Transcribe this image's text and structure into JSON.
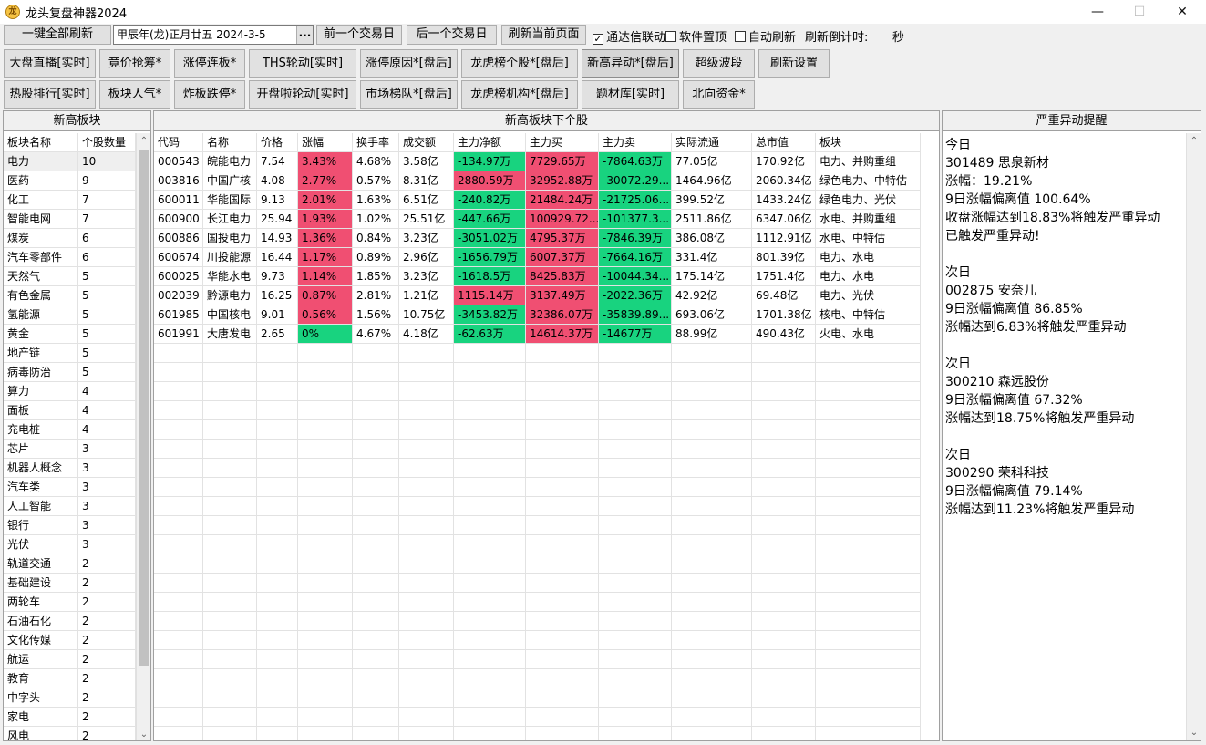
{
  "window": {
    "title": "龙头复盘神器2024",
    "app_icon_text": "龙",
    "minimize": "—",
    "maximize": "☐",
    "close": "✕"
  },
  "toolbar": {
    "refresh_all": "一键全部刷新",
    "date_value": "甲辰年(龙)正月廿五  2024-3-5",
    "date_picker": "...",
    "prev_day": "前一个交易日",
    "next_day": "后一个交易日",
    "refresh_page": "刷新当前页面",
    "tdx_link": "通达信联动",
    "tdx_link_checked": true,
    "pin_top": "软件置顶",
    "pin_top_checked": false,
    "auto_refresh": "自动刷新",
    "auto_refresh_checked": false,
    "countdown_label": "刷新倒计时:",
    "countdown_unit": "秒"
  },
  "nav_row1": [
    "大盘直播[实时]",
    "竟价抢筹*",
    "涨停连板*",
    "THS轮动[实时]",
    "涨停原因*[盘后]",
    "龙虎榜个股*[盘后]",
    "新高异动*[盘后]",
    "超级波段",
    "刷新设置"
  ],
  "nav_row2": [
    "热股排行[实时]",
    "板块人气*",
    "炸板跌停*",
    "开盘啦轮动[实时]",
    "市场梯队*[盘后]",
    "龙虎榜机构*[盘后]",
    "题材库[实时]",
    "北向资金*"
  ],
  "sectors": {
    "title": "新高板块",
    "columns": [
      "板块名称",
      "个股数量"
    ],
    "rows": [
      [
        "电力",
        "10"
      ],
      [
        "医药",
        "9"
      ],
      [
        "化工",
        "7"
      ],
      [
        "智能电网",
        "7"
      ],
      [
        "煤炭",
        "6"
      ],
      [
        "汽车零部件",
        "6"
      ],
      [
        "天然气",
        "5"
      ],
      [
        "有色金属",
        "5"
      ],
      [
        "氢能源",
        "5"
      ],
      [
        "黄金",
        "5"
      ],
      [
        "地产链",
        "5"
      ],
      [
        "病毒防治",
        "5"
      ],
      [
        "算力",
        "4"
      ],
      [
        "面板",
        "4"
      ],
      [
        "充电桩",
        "4"
      ],
      [
        "芯片",
        "3"
      ],
      [
        "机器人概念",
        "3"
      ],
      [
        "汽车类",
        "3"
      ],
      [
        "人工智能",
        "3"
      ],
      [
        "银行",
        "3"
      ],
      [
        "光伏",
        "3"
      ],
      [
        "轨道交通",
        "2"
      ],
      [
        "基础建设",
        "2"
      ],
      [
        "两轮车",
        "2"
      ],
      [
        "石油石化",
        "2"
      ],
      [
        "文化传媒",
        "2"
      ],
      [
        "航运",
        "2"
      ],
      [
        "教育",
        "2"
      ],
      [
        "中字头",
        "2"
      ],
      [
        "家电",
        "2"
      ],
      [
        "风电",
        "2"
      ]
    ]
  },
  "stocks": {
    "title": "新高板块下个股",
    "columns": [
      "代码",
      "名称",
      "价格",
      "涨幅",
      "换手率",
      "成交额",
      "主力净额",
      "主力买",
      "主力卖",
      "实际流通",
      "总市值",
      "板块"
    ],
    "rows": [
      [
        "000543",
        "皖能电力",
        "7.54",
        "3.43%",
        "4.68%",
        "3.58亿",
        "-134.97万",
        "7729.65万",
        "-7864.63万",
        "77.05亿",
        "170.92亿",
        "电力、并购重组"
      ],
      [
        "003816",
        "中国广核",
        "4.08",
        "2.77%",
        "0.57%",
        "8.31亿",
        "2880.59万",
        "32952.88万",
        "-30072.29...",
        "1464.96亿",
        "2060.34亿",
        "绿色电力、中特估"
      ],
      [
        "600011",
        "华能国际",
        "9.13",
        "2.01%",
        "1.63%",
        "6.51亿",
        "-240.82万",
        "21484.24万",
        "-21725.06...",
        "399.52亿",
        "1433.24亿",
        "绿色电力、光伏"
      ],
      [
        "600900",
        "长江电力",
        "25.94",
        "1.93%",
        "1.02%",
        "25.51亿",
        "-447.66万",
        "100929.72...",
        "-101377.3...",
        "2511.86亿",
        "6347.06亿",
        "水电、并购重组"
      ],
      [
        "600886",
        "国投电力",
        "14.93",
        "1.36%",
        "0.84%",
        "3.23亿",
        "-3051.02万",
        "4795.37万",
        "-7846.39万",
        "386.08亿",
        "1112.91亿",
        "水电、中特估"
      ],
      [
        "600674",
        "川投能源",
        "16.44",
        "1.17%",
        "0.89%",
        "2.96亿",
        "-1656.79万",
        "6007.37万",
        "-7664.16万",
        "331.4亿",
        "801.39亿",
        "电力、水电"
      ],
      [
        "600025",
        "华能水电",
        "9.73",
        "1.14%",
        "1.85%",
        "3.23亿",
        "-1618.5万",
        "8425.83万",
        "-10044.34...",
        "175.14亿",
        "1751.4亿",
        "电力、水电"
      ],
      [
        "002039",
        "黔源电力",
        "16.25",
        "0.87%",
        "2.81%",
        "1.21亿",
        "1115.14万",
        "3137.49万",
        "-2022.36万",
        "42.92亿",
        "69.48亿",
        "电力、光伏"
      ],
      [
        "601985",
        "中国核电",
        "9.01",
        "0.56%",
        "1.56%",
        "10.75亿",
        "-3453.82万",
        "32386.07万",
        "-35839.89...",
        "693.06亿",
        "1701.38亿",
        "核电、中特估"
      ],
      [
        "601991",
        "大唐发电",
        "2.65",
        "0%",
        "4.67%",
        "4.18亿",
        "-62.63万",
        "14614.37万",
        "-14677万",
        "88.99亿",
        "490.43亿",
        "火电、水电"
      ]
    ],
    "change_colors": [
      "red",
      "red",
      "red",
      "red",
      "red",
      "red",
      "red",
      "red",
      "red",
      "green"
    ],
    "net_colors": [
      "green",
      "red",
      "green",
      "green",
      "green",
      "green",
      "green",
      "red",
      "green",
      "green"
    ]
  },
  "colors": {
    "up": "#f04f72",
    "down": "#18d37f"
  },
  "alerts": {
    "title": "严重异动提醒",
    "lines": [
      "今日",
      "301489 思泉新材",
      "涨幅：19.21%",
      "9日涨幅偏离值 100.64%",
      "收盘涨幅达到18.83%将触发严重异动",
      "已触发严重异动!",
      "",
      "次日",
      "002875 安奈儿",
      "9日涨幅偏离值 86.85%",
      "涨幅达到6.83%将触发严重异动",
      "",
      "次日",
      "300210 森远股份",
      "9日涨幅偏离值 67.32%",
      "涨幅达到18.75%将触发严重异动",
      "",
      "次日",
      "300290 荣科科技",
      "9日涨幅偏离值 79.14%",
      "涨幅达到11.23%将触发严重异动"
    ]
  }
}
